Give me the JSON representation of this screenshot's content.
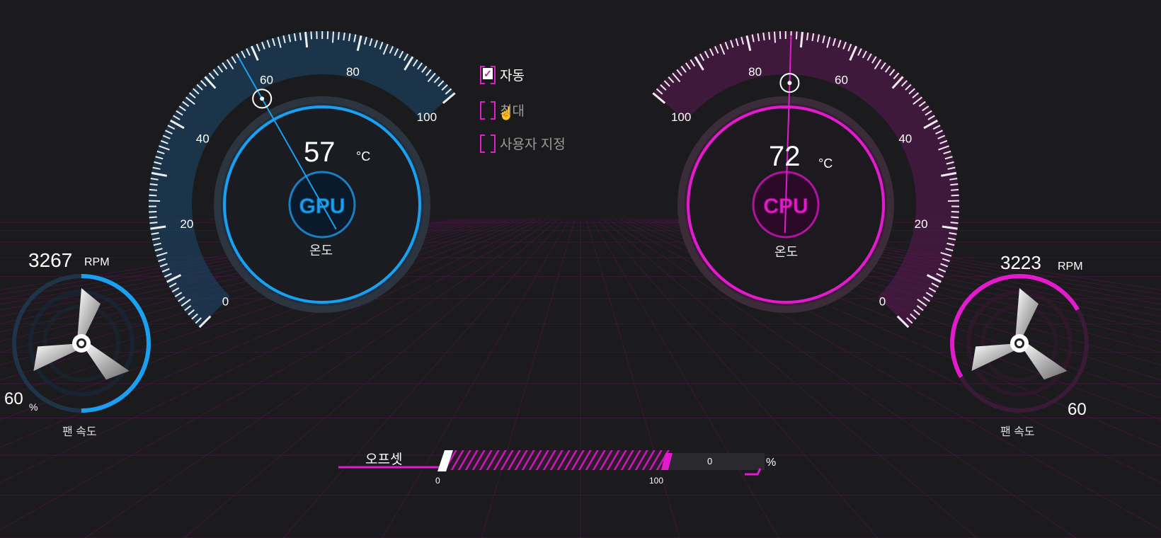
{
  "gpu": {
    "label": "GPU",
    "temp_value": "57",
    "temp_unit": "°C",
    "caption": "온도",
    "scale_labels": [
      "0",
      "20",
      "40",
      "60",
      "80",
      "100"
    ],
    "needle_value": 57,
    "color": "#1aa0f0",
    "fan": {
      "rpm": "3267",
      "rpm_unit": "RPM",
      "percent": "60",
      "percent_unit": "%",
      "caption": "팬 속도",
      "fill_fraction": 0.6
    }
  },
  "cpu": {
    "label": "CPU",
    "temp_value": "72",
    "temp_unit": "°C",
    "caption": "온도",
    "scale_labels": [
      "0",
      "20",
      "40",
      "60",
      "80",
      "100"
    ],
    "needle_value": 72,
    "color": "#e21ccc",
    "fan": {
      "rpm": "3223",
      "rpm_unit": "RPM",
      "percent": "60",
      "percent_unit": "%",
      "caption": "팬 속도",
      "fill_fraction": 0.6
    }
  },
  "mode": {
    "options": [
      {
        "label": "자동",
        "checked": true
      },
      {
        "label": "최대",
        "checked": false
      },
      {
        "label": "사용자 지정",
        "checked": false
      }
    ]
  },
  "offset": {
    "label": "오프셋",
    "min": "0",
    "max": "100",
    "value": "0",
    "unit": "%"
  },
  "colors": {
    "background": "#1b1a1d",
    "gpu_accent": "#1aa0f0",
    "cpu_accent": "#e21ccc"
  }
}
